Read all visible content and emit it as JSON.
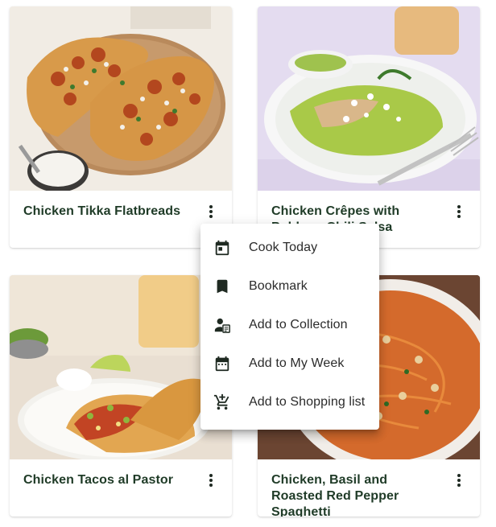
{
  "recipes": [
    {
      "title": "Chicken Tikka Flatbreads"
    },
    {
      "title": "Chicken Crêpes with Poblano Chili Salsa"
    },
    {
      "title": "Chicken Tacos al Pastor"
    },
    {
      "title": "Chicken, Basil and Roasted Red Pepper Spaghetti"
    }
  ],
  "context_menu": {
    "items": [
      {
        "label": "Cook Today",
        "icon": "calendar-today-icon"
      },
      {
        "label": "Bookmark",
        "icon": "bookmark-icon"
      },
      {
        "label": "Add to Collection",
        "icon": "add-to-collection-icon"
      },
      {
        "label": "Add to My Week",
        "icon": "calendar-week-icon"
      },
      {
        "label": "Add to Shopping list",
        "icon": "add-shopping-cart-icon"
      }
    ]
  },
  "colors": {
    "title_text": "#1f3b27",
    "menu_text": "#2b2b2b",
    "icon": "#1f2a22"
  }
}
